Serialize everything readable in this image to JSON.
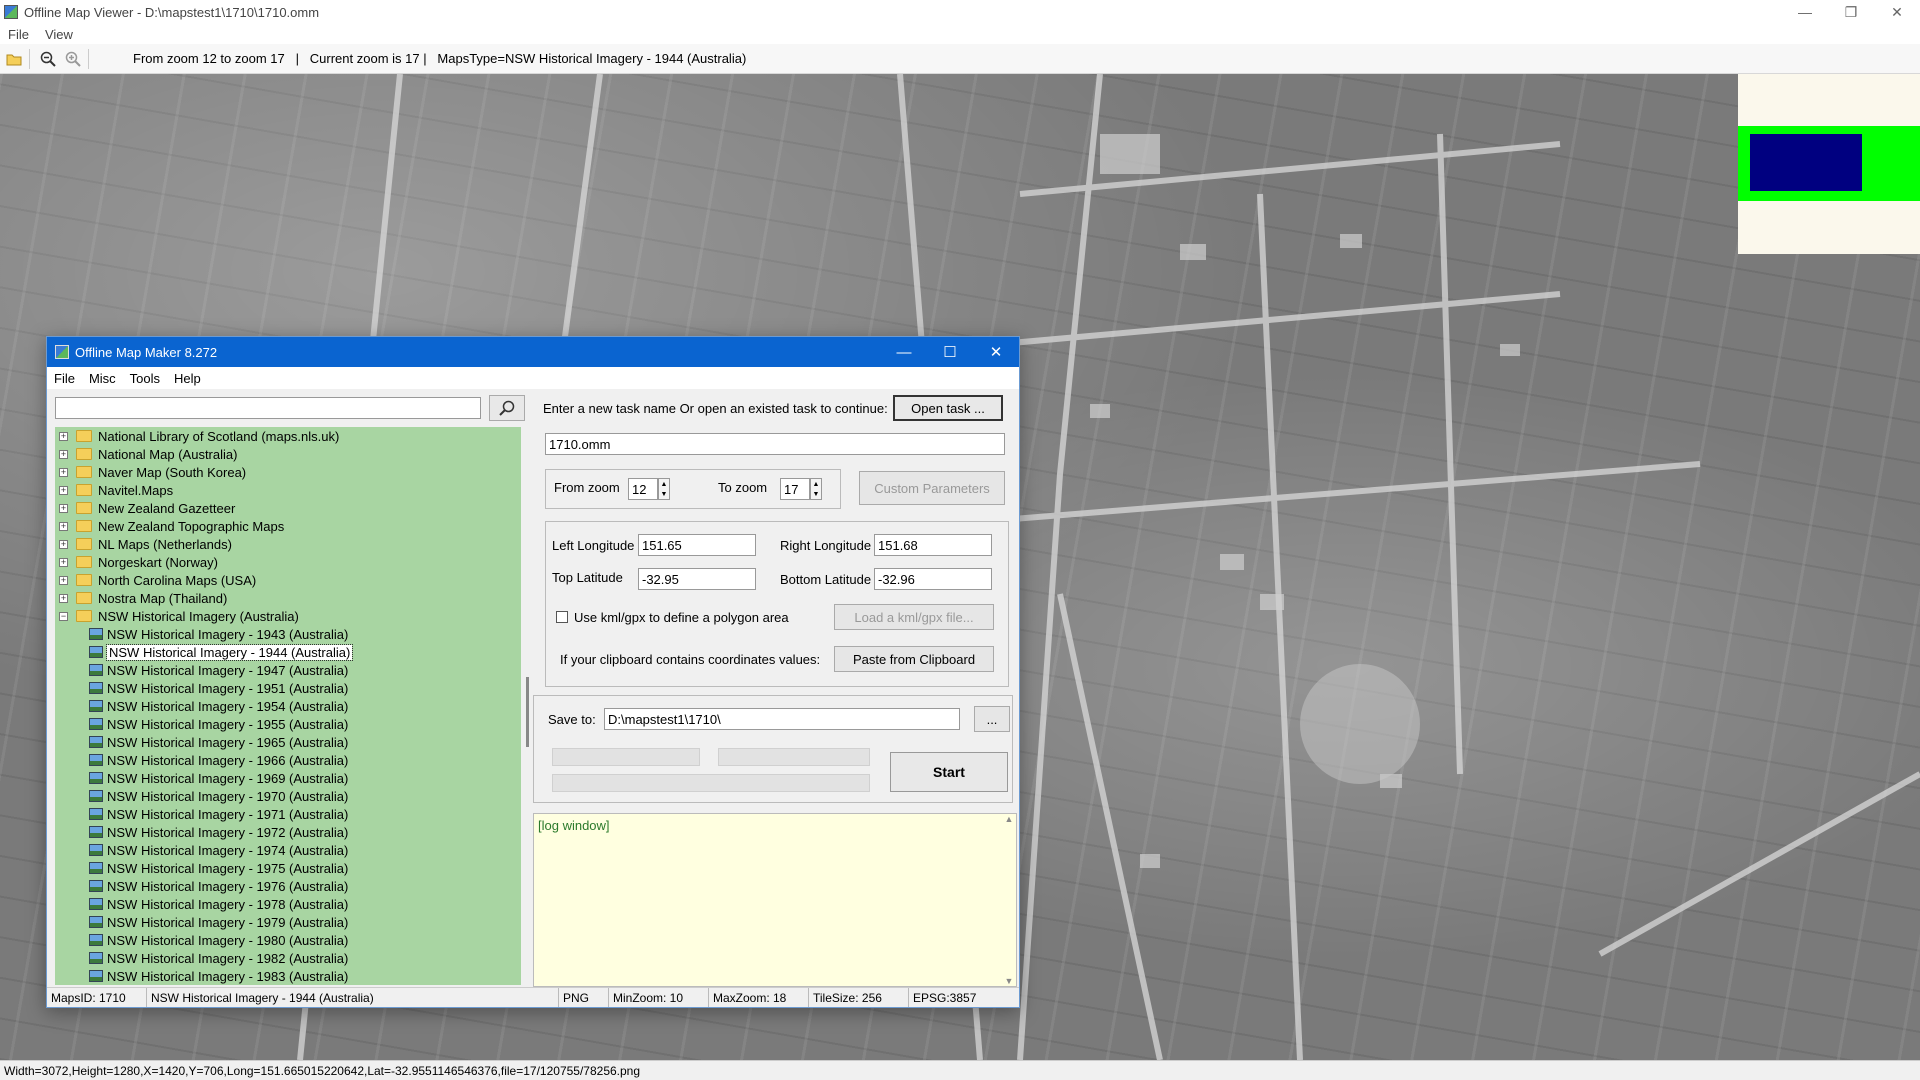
{
  "viewer": {
    "title": "Offline Map Viewer - D:\\mapstest1\\1710\\1710.omm",
    "menu": [
      "File",
      "View"
    ],
    "toolbar_info": "From zoom 12 to zoom 17   |   Current zoom is 17 |   MapsType=NSW Historical Imagery - 1944 (Australia)",
    "status": "Width=3072,Height=1280,X=1420,Y=706,Long=151.665015220642,Lat=-32.9551146546376,file=17/120755/78256.png",
    "window_controls": [
      "minimize-icon",
      "restore-icon",
      "close-icon"
    ]
  },
  "dialog": {
    "title": "Offline Map Maker 8.272",
    "menu": [
      "File",
      "Misc",
      "Tools",
      "Help"
    ],
    "search_placeholder": "",
    "tree_folders": [
      "National Library of Scotland (maps.nls.uk)",
      "National Map (Australia)",
      "Naver Map (South Korea)",
      "Navitel.Maps",
      "New Zealand Gazetteer",
      "New Zealand Topographic Maps",
      "NL Maps (Netherlands)",
      "Norgeskart (Norway)",
      "North Carolina Maps (USA)",
      "Nostra Map (Thailand)"
    ],
    "tree_open_folder": "NSW Historical Imagery (Australia)",
    "tree_children": [
      "NSW Historical Imagery - 1943 (Australia)",
      "NSW Historical Imagery - 1944 (Australia)",
      "NSW Historical Imagery - 1947 (Australia)",
      "NSW Historical Imagery - 1951 (Australia)",
      "NSW Historical Imagery - 1954 (Australia)",
      "NSW Historical Imagery - 1955 (Australia)",
      "NSW Historical Imagery - 1965 (Australia)",
      "NSW Historical Imagery - 1966 (Australia)",
      "NSW Historical Imagery - 1969 (Australia)",
      "NSW Historical Imagery - 1970 (Australia)",
      "NSW Historical Imagery - 1971 (Australia)",
      "NSW Historical Imagery - 1972 (Australia)",
      "NSW Historical Imagery - 1974 (Australia)",
      "NSW Historical Imagery - 1975 (Australia)",
      "NSW Historical Imagery - 1976 (Australia)",
      "NSW Historical Imagery - 1978 (Australia)",
      "NSW Historical Imagery - 1979 (Australia)",
      "NSW Historical Imagery - 1980 (Australia)",
      "NSW Historical Imagery - 1982 (Australia)",
      "NSW Historical Imagery - 1983 (Australia)"
    ],
    "selected_child": "NSW Historical Imagery - 1944 (Australia)",
    "task_prompt": "Enter a new task name Or open an existed task to continue:",
    "open_task_label": "Open task ...",
    "task_name": "1710.omm",
    "from_zoom_label": "From zoom",
    "from_zoom_value": "12",
    "to_zoom_label": "To zoom",
    "to_zoom_value": "17",
    "custom_params_label": "Custom Parameters",
    "left_lon_label": "Left Longitude",
    "left_lon_value": "151.65",
    "right_lon_label": "Right Longitude",
    "right_lon_value": "151.68",
    "top_lat_label": "Top Latitude",
    "top_lat_value": "-32.95",
    "bottom_lat_label": "Bottom Latitude",
    "bottom_lat_value": "-32.96",
    "kml_checkbox_label": "Use kml/gpx to define a polygon area",
    "load_kml_label": "Load a kml/gpx file...",
    "clipboard_label": "If your clipboard contains coordinates values:",
    "paste_label": "Paste from Clipboard",
    "save_to_label": "Save to:",
    "save_to_value": "D:\\mapstest1\\1710\\",
    "browse_label": "...",
    "start_label": "Start",
    "log_title": "[log window]",
    "status": {
      "maps_id": "MapsID: 1710",
      "maps_name": "NSW Historical Imagery - 1944 (Australia)",
      "format": "PNG",
      "min_zoom": "MinZoom: 10",
      "max_zoom": "MaxZoom: 18",
      "tile_size": "TileSize: 256",
      "epsg": "EPSG:3857"
    }
  },
  "colors": {
    "tree_bg": "#a8d5a2",
    "dialog_title_bg": "#0a64d0",
    "log_bg": "#ffffe0",
    "overview_green": "#00ff00",
    "overview_navy": "#000080"
  }
}
